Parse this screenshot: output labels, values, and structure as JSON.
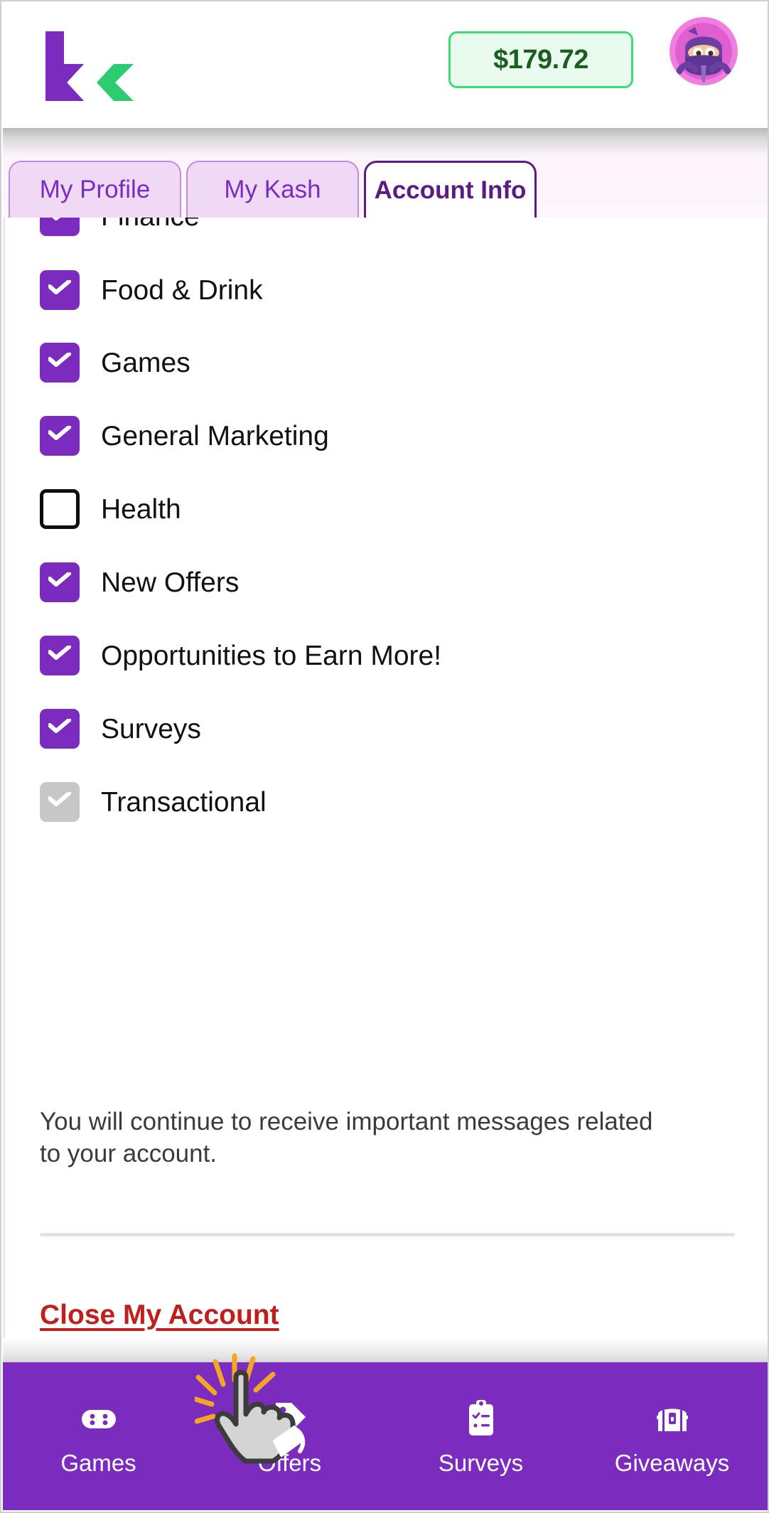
{
  "header": {
    "logo_name": "kashkick-logo",
    "balance": "$179.72",
    "avatar_name": "ninja-avatar"
  },
  "tabs": [
    {
      "label": "My Profile",
      "active": false
    },
    {
      "label": "My Kash",
      "active": false
    },
    {
      "label": "Account Info",
      "active": true
    }
  ],
  "preferences": {
    "items": [
      {
        "label": "Finance",
        "state": "checked"
      },
      {
        "label": "Food & Drink",
        "state": "checked"
      },
      {
        "label": "Games",
        "state": "checked"
      },
      {
        "label": "General Marketing",
        "state": "checked"
      },
      {
        "label": "Health",
        "state": "unchecked"
      },
      {
        "label": "New Offers",
        "state": "checked"
      },
      {
        "label": "Opportunities to Earn More!",
        "state": "checked"
      },
      {
        "label": "Surveys",
        "state": "checked"
      },
      {
        "label": "Transactional",
        "state": "disabled"
      }
    ],
    "helper_text": "You will continue to receive important messages related to your account.",
    "close_account_label": "Close My Account"
  },
  "bottom_nav": [
    {
      "label": "Games",
      "icon": "gamepad-icon"
    },
    {
      "label": "Offers",
      "icon": "tag-icon"
    },
    {
      "label": "Surveys",
      "icon": "clipboard-checklist-icon"
    },
    {
      "label": "Giveaways",
      "icon": "treasure-chest-icon"
    }
  ],
  "cursor": {
    "name": "pointing-hand-click-cursor"
  },
  "colors": {
    "brand_purple": "#7b2cbf",
    "dark_purple": "#5b1a86",
    "tab_inactive_bg": "#efd9f5",
    "balance_green": "#3ddb72",
    "balance_text": "#1b5e20",
    "danger_red": "#c0201d",
    "disabled_gray": "#c7c7c7"
  }
}
